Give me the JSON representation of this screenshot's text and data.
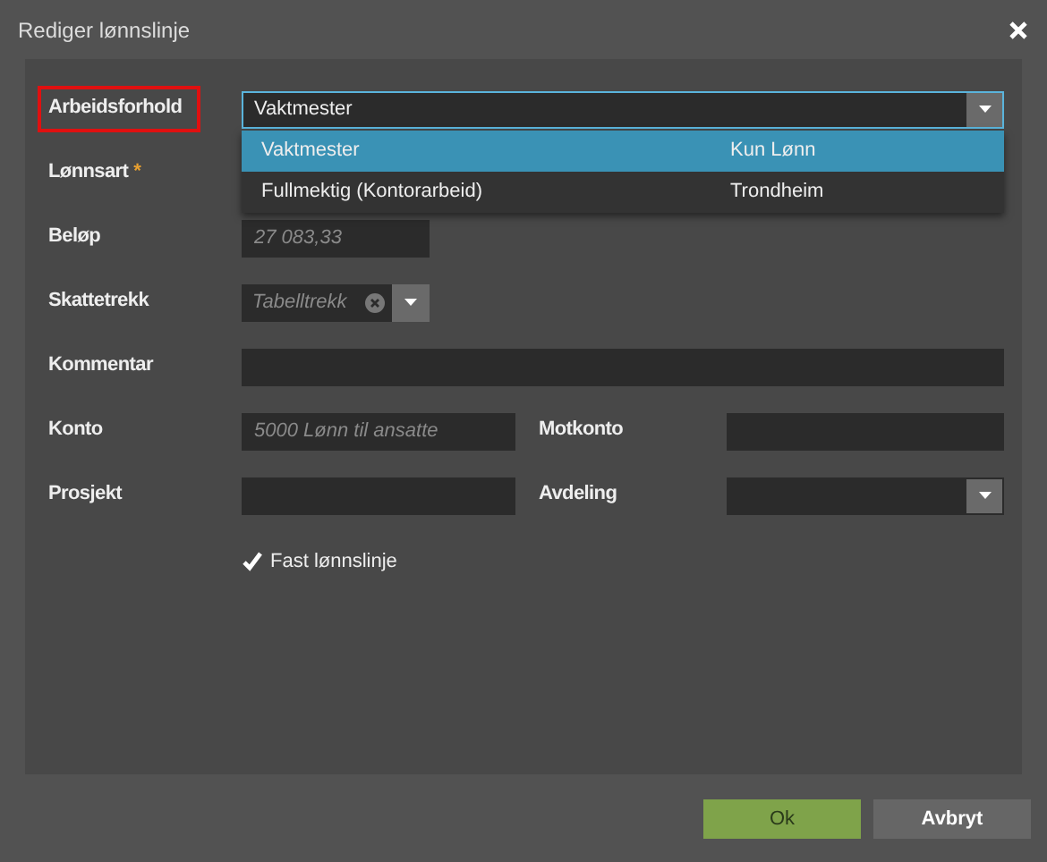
{
  "dialog": {
    "title": "Rediger lønnslinje"
  },
  "rows": [
    {
      "fields": [
        {
          "label": "Arbeidsforhold",
          "kind": "dropdown",
          "value": "Vaktmester",
          "focused": true,
          "highlighted": true,
          "expanded": true,
          "options": [
            {
              "label": "Vaktmester",
              "detail": "Kun Lønn",
              "selected": true
            },
            {
              "label": "Fullmektig (Kontorarbeid)",
              "detail": "Trondheim",
              "selected": false
            }
          ]
        }
      ]
    },
    {
      "fields": [
        {
          "label": "Lønnsart",
          "kind": "text",
          "required_mark": "*"
        }
      ]
    },
    {
      "fields": [
        {
          "label": "Beløp",
          "kind": "amount",
          "placeholder": "27 083,33"
        }
      ]
    },
    {
      "fields": [
        {
          "label": "Skattetrekk",
          "kind": "select",
          "placeholder": "Tabelltrekk"
        }
      ]
    },
    {
      "fields": [
        {
          "label": "Kommentar",
          "kind": "text"
        }
      ]
    },
    {
      "fields": [
        {
          "label": "Konto",
          "kind": "text",
          "placeholder": "5000 Lønn til ansatte"
        },
        {
          "label": "Motkonto",
          "kind": "text"
        }
      ]
    },
    {
      "fields": [
        {
          "label": "Prosjekt",
          "kind": "text"
        },
        {
          "label": "Avdeling",
          "kind": "dropdown"
        }
      ]
    }
  ],
  "checkbox": {
    "label": "Fast lønnslinje",
    "checked": true
  },
  "buttons": [
    {
      "label": "Ok",
      "kind": "primary"
    },
    {
      "label": "Avbryt",
      "kind": "secondary"
    }
  ]
}
